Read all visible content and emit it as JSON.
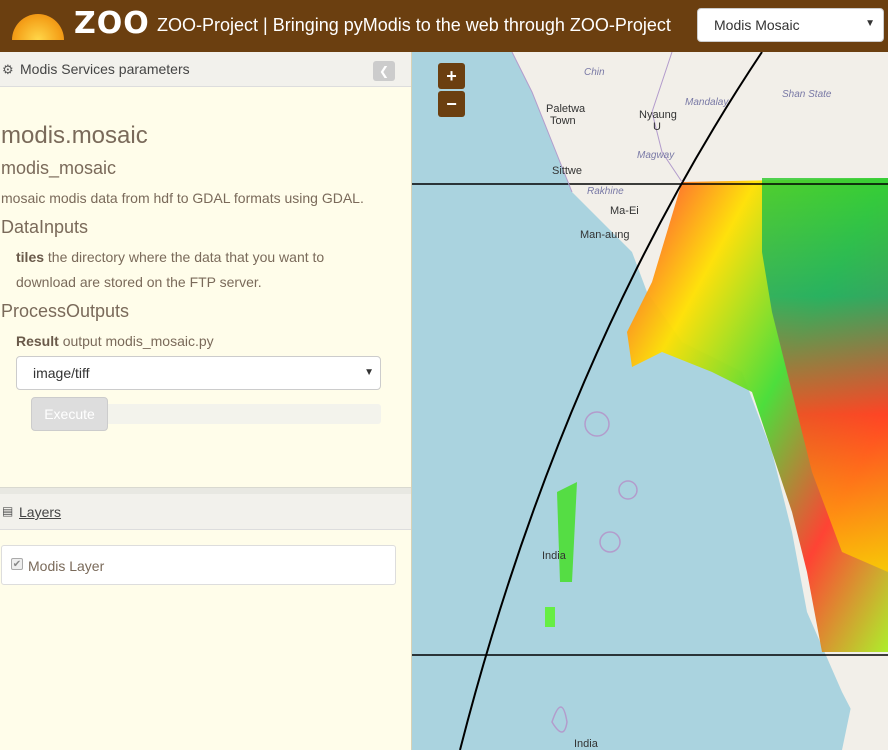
{
  "header": {
    "logo_text": "ZOO",
    "title": "ZOO-Project | Bringing pyModis to the web through ZOO-Project",
    "select_value": "Modis Mosaic"
  },
  "panel": {
    "heading": "Modis Services parameters",
    "process_name": "modis.mosaic",
    "process_id": "modis_mosaic",
    "description": "mosaic modis data from hdf to GDAL formats using GDAL.",
    "inputs_heading": "DataInputs",
    "input_name": "tiles",
    "input_desc": "the directory where the data that you want to download are stored on the FTP server.",
    "outputs_heading": "ProcessOutputs",
    "output_name": "Result",
    "output_desc": "output modis_mosaic.py",
    "format_value": "image/tiff",
    "execute_label": "Execute"
  },
  "layers": {
    "heading": "Layers",
    "items": [
      {
        "label": "Modis Layer",
        "checked": true
      }
    ]
  },
  "map": {
    "zoom_in": "+",
    "zoom_out": "−",
    "labels": {
      "chin": "Chin",
      "mandalay": "Mandalay",
      "shan_state": "Shan State",
      "paletwa": "Paletwa",
      "town": "Town",
      "nyaung": "Nyaung",
      "u": "U",
      "magway": "Magway",
      "sittwe": "Sittwe",
      "rakhine": "Rakhine",
      "ma_ei": "Ma-Ei",
      "man_aung": "Man-aung",
      "india1": "India",
      "india2": "India"
    }
  },
  "colors": {
    "header_bg": "#6b3f10",
    "panel_bg": "#fffdea",
    "sea": "#aad3df",
    "land": "#f2efe9"
  }
}
